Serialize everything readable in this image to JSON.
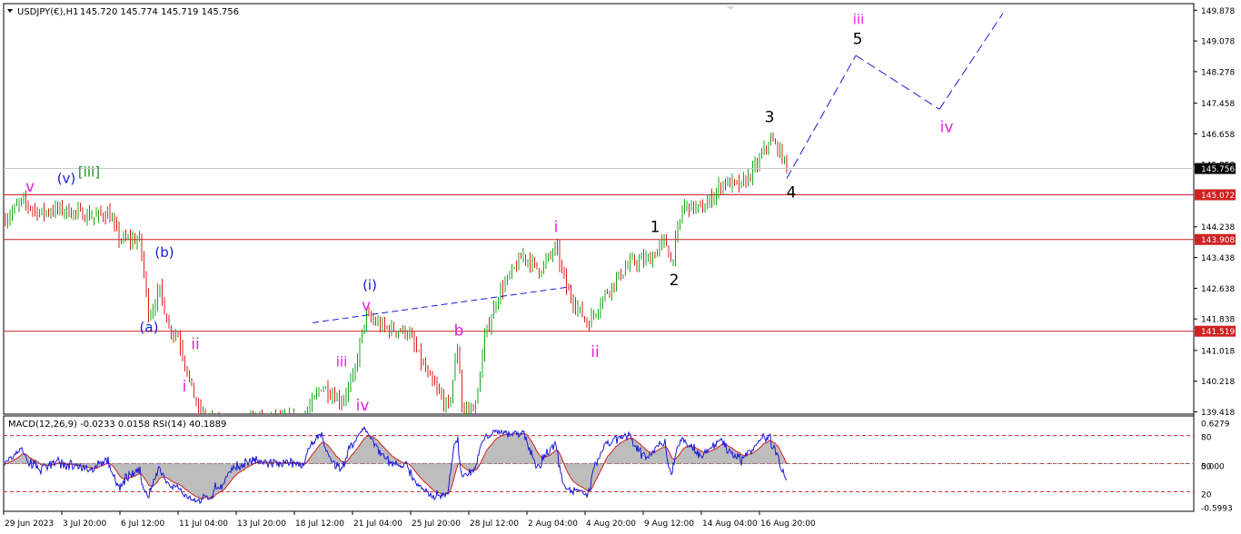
{
  "header": {
    "symbol_line": "USDJPY(€),H1",
    "ohlc_line": "145.720 145.774 145.719 145.756"
  },
  "chart_data": {
    "type": "candlestick",
    "instrument": "USDJPY(€),H1",
    "price_axis": {
      "ylim": [
        139.36,
        150.05
      ],
      "ticks": [
        "149.878",
        "149.078",
        "148.278",
        "147.458",
        "146.658",
        "145.858",
        "145.072",
        "144.238",
        "143.908",
        "143.438",
        "142.638",
        "141.838",
        "141.519",
        "141.018",
        "140.218",
        "139.418"
      ],
      "current_price": "145.756"
    },
    "time_axis": {
      "labels": [
        "29 Jun 2023",
        "3 Jul 20:00",
        "6 Jul 12:00",
        "11 Jul 04:00",
        "13 Jul 20:00",
        "18 Jul 12:00",
        "21 Jul 04:00",
        "25 Jul 20:00",
        "28 Jul 12:00",
        "2 Aug 04:00",
        "4 Aug 20:00",
        "9 Aug 12:00",
        "14 Aug 04:00",
        "16 Aug 20:00"
      ]
    },
    "horizontal_levels": [
      {
        "price": 145.072,
        "label": "145.072"
      },
      {
        "price": 143.908,
        "label": "143.908"
      },
      {
        "price": 141.519,
        "label": "141.519"
      }
    ],
    "price_path": [
      {
        "t": 0,
        "p": 144.4
      },
      {
        "t": 20,
        "p": 144.9
      },
      {
        "t": 40,
        "p": 144.6
      },
      {
        "t": 60,
        "p": 144.7
      },
      {
        "t": 80,
        "p": 144.6
      },
      {
        "t": 100,
        "p": 144.5
      },
      {
        "t": 115,
        "p": 144.6
      },
      {
        "t": 128,
        "p": 143.9
      },
      {
        "t": 150,
        "p": 143.9
      },
      {
        "t": 160,
        "p": 141.9
      },
      {
        "t": 172,
        "p": 142.6
      },
      {
        "t": 182,
        "p": 141.6
      },
      {
        "t": 192,
        "p": 141.4
      },
      {
        "t": 205,
        "p": 140.2
      },
      {
        "t": 215,
        "p": 139.4
      },
      {
        "t": 240,
        "p": 139.0
      },
      {
        "t": 275,
        "p": 139.2
      },
      {
        "t": 330,
        "p": 139.2
      },
      {
        "t": 350,
        "p": 140.1
      },
      {
        "t": 372,
        "p": 139.7
      },
      {
        "t": 385,
        "p": 140.3
      },
      {
        "t": 398,
        "p": 141.9
      },
      {
        "t": 420,
        "p": 141.6
      },
      {
        "t": 445,
        "p": 141.5
      },
      {
        "t": 468,
        "p": 140.3
      },
      {
        "t": 490,
        "p": 139.5
      },
      {
        "t": 500,
        "p": 141.2
      },
      {
        "t": 505,
        "p": 139.4
      },
      {
        "t": 520,
        "p": 139.6
      },
      {
        "t": 530,
        "p": 141.4
      },
      {
        "t": 545,
        "p": 142.5
      },
      {
        "t": 572,
        "p": 143.5
      },
      {
        "t": 590,
        "p": 143.1
      },
      {
        "t": 608,
        "p": 143.7
      },
      {
        "t": 620,
        "p": 142.6
      },
      {
        "t": 643,
        "p": 141.7
      },
      {
        "t": 665,
        "p": 142.6
      },
      {
        "t": 690,
        "p": 143.3
      },
      {
        "t": 712,
        "p": 143.4
      },
      {
        "t": 728,
        "p": 143.9
      },
      {
        "t": 735,
        "p": 143.3
      },
      {
        "t": 748,
        "p": 144.8
      },
      {
        "t": 770,
        "p": 144.7
      },
      {
        "t": 792,
        "p": 145.4
      },
      {
        "t": 812,
        "p": 145.3
      },
      {
        "t": 828,
        "p": 145.8
      },
      {
        "t": 843,
        "p": 146.5
      },
      {
        "t": 852,
        "p": 146.3
      },
      {
        "t": 862,
        "p": 145.8
      }
    ],
    "projection": [
      {
        "t": 862,
        "p": 145.5
      },
      {
        "t": 938,
        "p": 148.7
      },
      {
        "t": 1030,
        "p": 147.3
      },
      {
        "t": 1100,
        "p": 149.8
      }
    ],
    "trend_line": [
      {
        "t": 340,
        "p": 141.74
      },
      {
        "t": 625,
        "p": 142.68
      }
    ],
    "wave_labels": [
      {
        "text": "v",
        "color": "#e020e0",
        "t": 29,
        "p": 145.15
      },
      {
        "text": "(v)",
        "color": "#1a1ad6",
        "t": 69,
        "p": 145.38
      },
      {
        "text": "[iii]",
        "color": "#1e8c1e",
        "t": 94,
        "p": 145.55
      },
      {
        "text": "(b)",
        "color": "#1a1ad6",
        "t": 177,
        "p": 143.45
      },
      {
        "text": "(a)",
        "color": "#1a1ad6",
        "t": 160,
        "p": 141.5
      },
      {
        "text": "ii",
        "color": "#e020e0",
        "t": 211,
        "p": 141.05
      },
      {
        "text": "i",
        "color": "#e020e0",
        "t": 199,
        "p": 139.95
      },
      {
        "text": "iii",
        "color": "#e020e0",
        "t": 372,
        "p": 140.6
      },
      {
        "text": "iv",
        "color": "#e020e0",
        "t": 395,
        "p": 139.46
      },
      {
        "text": "(i)",
        "color": "#1a1ad6",
        "t": 403,
        "p": 142.6
      },
      {
        "text": "v",
        "color": "#e020e0",
        "t": 399,
        "p": 142.06
      },
      {
        "text": "b",
        "color": "#e020e0",
        "t": 501,
        "p": 141.4
      },
      {
        "text": "i",
        "color": "#e020e0",
        "t": 608,
        "p": 144.1
      },
      {
        "text": "ii",
        "color": "#e020e0",
        "t": 651,
        "p": 140.85
      },
      {
        "text": "1",
        "color": "#000000",
        "t": 717,
        "p": 144.1
      },
      {
        "text": "2",
        "color": "#000000",
        "t": 738,
        "p": 142.72
      },
      {
        "text": "3",
        "color": "#000000",
        "t": 843,
        "p": 146.96
      },
      {
        "text": "4",
        "color": "#000000",
        "t": 867,
        "p": 145.0
      },
      {
        "text": "5",
        "color": "#000000",
        "t": 940,
        "p": 149.0
      },
      {
        "text": "iii",
        "color": "#e020e0",
        "t": 941,
        "p": 149.52
      },
      {
        "text": "iv",
        "color": "#e020e0",
        "t": 1038,
        "p": 146.7
      }
    ],
    "indicator": {
      "label": "MACD(12,26,9) -0.0233 0.0158  RSI(14) 40.1889",
      "ticks": [
        "0.6279",
        "80",
        "0.000",
        "50",
        "20",
        "-0.5993"
      ],
      "levels": [
        80,
        50,
        20
      ]
    }
  },
  "colors": {
    "candle_up": "#15a815",
    "candle_down": "#dd1c1c",
    "level_line": "#cc2222",
    "projection": "#1a1ad6",
    "rsi": "#1a1ad6",
    "macd_signal": "#cc2222",
    "macd_hist": "#bdbdbd"
  }
}
